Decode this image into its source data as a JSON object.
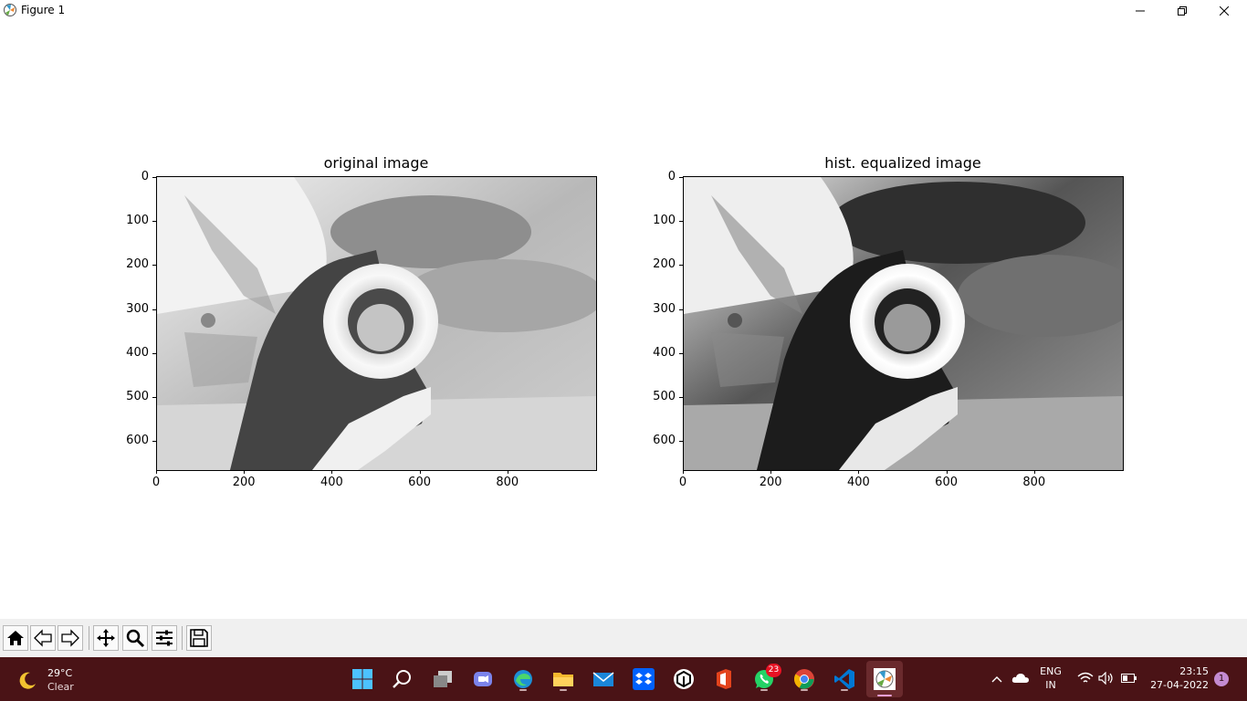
{
  "window": {
    "title": "Figure 1",
    "controls": [
      "minimize",
      "maximize",
      "close"
    ]
  },
  "figure": {
    "axes": [
      {
        "title": "original image",
        "xticks": [
          "0",
          "200",
          "400",
          "600",
          "800"
        ],
        "yticks": [
          "0",
          "100",
          "200",
          "300",
          "400",
          "500",
          "600"
        ],
        "image_variant": "original"
      },
      {
        "title": "hist. equalized image",
        "xticks": [
          "0",
          "200",
          "400",
          "600",
          "800"
        ],
        "yticks": [
          "0",
          "100",
          "200",
          "300",
          "400",
          "500",
          "600"
        ],
        "image_variant": "equalized"
      }
    ]
  },
  "toolbar": {
    "buttons": [
      {
        "name": "home",
        "icon": "home-icon"
      },
      {
        "name": "back",
        "icon": "back-arrow-icon"
      },
      {
        "name": "forward",
        "icon": "forward-arrow-icon"
      },
      {
        "name": "pan",
        "icon": "move-icon"
      },
      {
        "name": "zoom",
        "icon": "magnifier-icon"
      },
      {
        "name": "configure",
        "icon": "sliders-icon"
      },
      {
        "name": "save",
        "icon": "floppy-icon"
      }
    ]
  },
  "taskbar": {
    "weather": {
      "temp": "29°C",
      "condition": "Clear"
    },
    "apps": [
      {
        "name": "start",
        "icon": "windows-icon"
      },
      {
        "name": "search",
        "icon": "search-icon"
      },
      {
        "name": "task-view",
        "icon": "task-view-icon"
      },
      {
        "name": "teams-chat",
        "icon": "chat-icon"
      },
      {
        "name": "edge",
        "icon": "edge-icon"
      },
      {
        "name": "file-explorer",
        "icon": "folder-icon"
      },
      {
        "name": "mail",
        "icon": "mail-icon"
      },
      {
        "name": "dropbox",
        "icon": "dropbox-icon"
      },
      {
        "name": "app-hex",
        "icon": "hexagon-icon"
      },
      {
        "name": "office",
        "icon": "office-icon"
      },
      {
        "name": "whatsapp",
        "icon": "whatsapp-icon",
        "badge": "23"
      },
      {
        "name": "chrome",
        "icon": "chrome-icon"
      },
      {
        "name": "vscode",
        "icon": "vscode-icon"
      },
      {
        "name": "matplotlib-figure",
        "icon": "matplotlib-icon"
      }
    ],
    "tray": {
      "lang": "ENG",
      "region": "IN",
      "time": "23:15",
      "date": "27-04-2022",
      "notifications": "1"
    }
  },
  "colors": {
    "taskbar_bg": "#4a1316",
    "toolbar_bg": "#f0f0f0",
    "badge_red": "#e81123",
    "notification_purple": "#c48bd1"
  }
}
